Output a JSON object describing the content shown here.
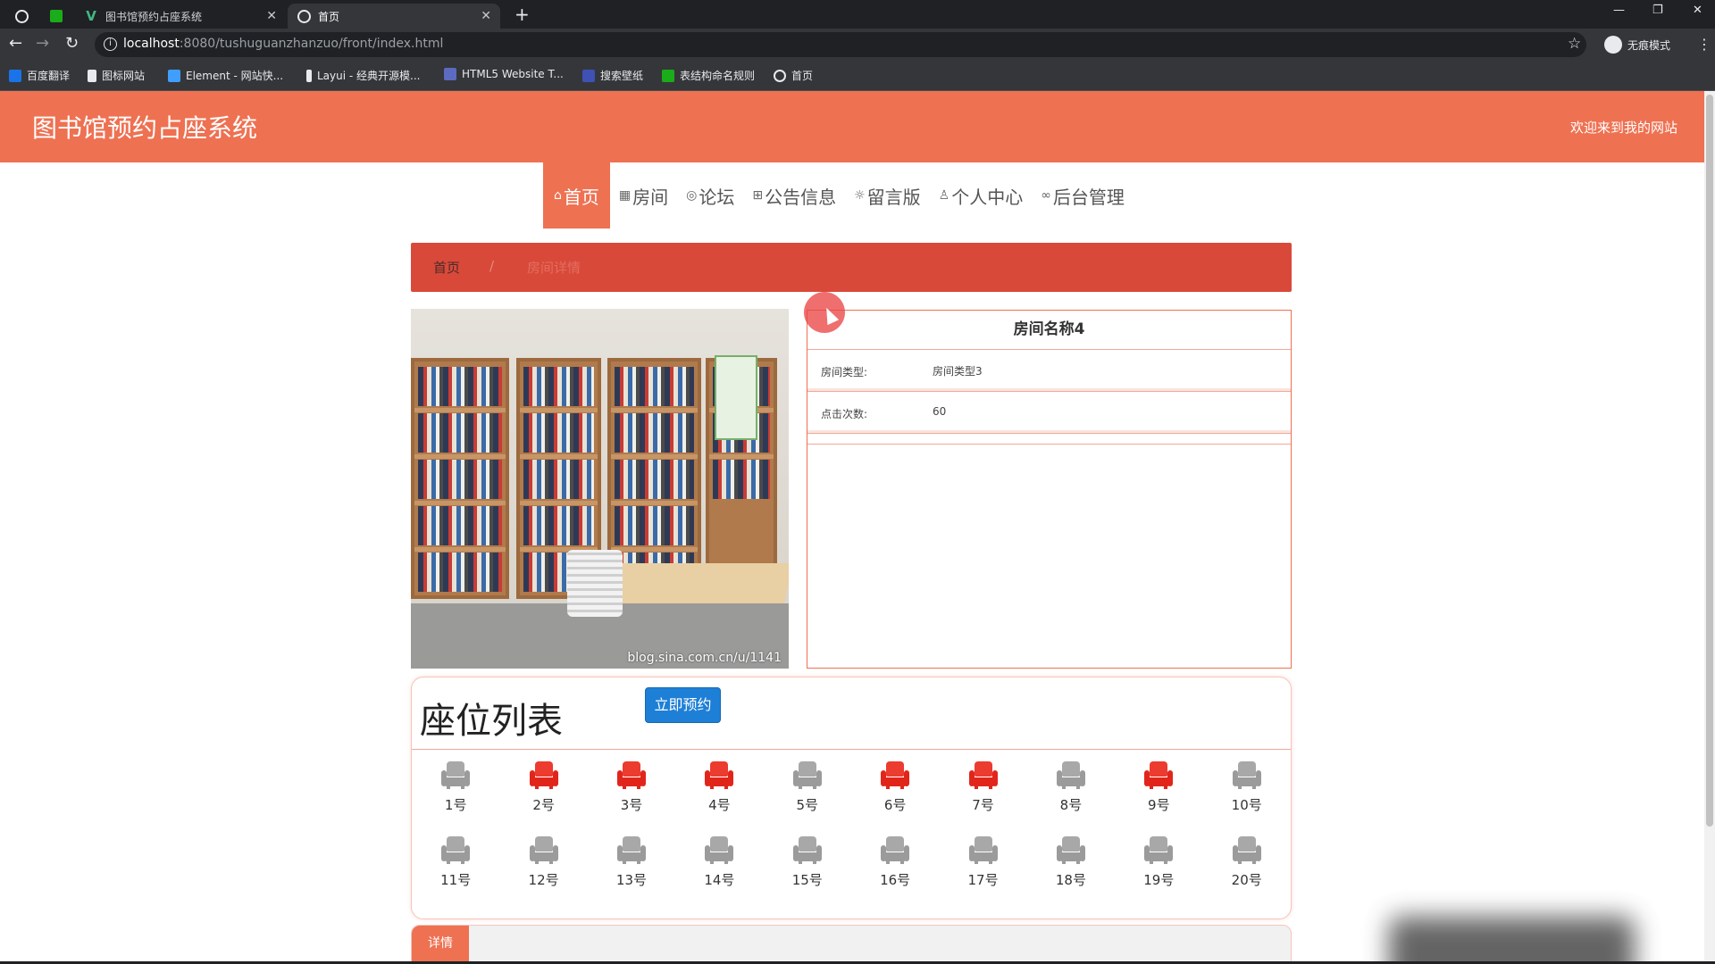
{
  "browser": {
    "tabs": [
      {
        "title": "图书馆预约占座系统",
        "active": false
      },
      {
        "title": "首页",
        "active": true
      }
    ],
    "url_host": "localhost",
    "url_rest": ":8080/tushuguanzhanzuo/front/index.html",
    "profile_label": "无痕模式",
    "bookmarks": [
      "百度翻译",
      "图标网站",
      "Element - 网站快...",
      "Layui - 经典开源模...",
      "HTML5 Website T...",
      "搜索壁纸",
      "表结构命名规则",
      "首页"
    ],
    "accent": "#35363a"
  },
  "site": {
    "title": "图书馆预约占座系统",
    "welcome": "欢迎来到我的网站",
    "brand_color": "#ee7152"
  },
  "nav": {
    "items": [
      {
        "icon": "home-icon",
        "label": "首页",
        "active": true
      },
      {
        "icon": "grid-icon",
        "label": "房间",
        "active": false
      },
      {
        "icon": "chat-icon",
        "label": "论坛",
        "active": false
      },
      {
        "icon": "book-icon",
        "label": "公告信息",
        "active": false
      },
      {
        "icon": "settings-icon",
        "label": "留言版",
        "active": false
      },
      {
        "icon": "user-icon",
        "label": "个人中心",
        "active": false
      },
      {
        "icon": "link-icon",
        "label": "后台管理",
        "active": false
      }
    ]
  },
  "breadcrumb": {
    "home": "首页",
    "separator": "/",
    "current": "房间详情"
  },
  "room": {
    "name": "房间名称4",
    "type_label": "房间类型:",
    "type_value": "房间类型3",
    "clicks_label": "点击次数:",
    "clicks_value": "60",
    "photo_watermark": "blog.sina.com.cn/u/1141"
  },
  "seats": {
    "title": "座位列表",
    "reserve_label": "立即预约",
    "taken_color": "#e2251b",
    "free_color": "#9b9b9b",
    "list": [
      {
        "label": "1号",
        "taken": false
      },
      {
        "label": "2号",
        "taken": true
      },
      {
        "label": "3号",
        "taken": true
      },
      {
        "label": "4号",
        "taken": true
      },
      {
        "label": "5号",
        "taken": false
      },
      {
        "label": "6号",
        "taken": true
      },
      {
        "label": "7号",
        "taken": true
      },
      {
        "label": "8号",
        "taken": false
      },
      {
        "label": "9号",
        "taken": true
      },
      {
        "label": "10号",
        "taken": false
      },
      {
        "label": "11号",
        "taken": false
      },
      {
        "label": "12号",
        "taken": false
      },
      {
        "label": "13号",
        "taken": false
      },
      {
        "label": "14号",
        "taken": false
      },
      {
        "label": "15号",
        "taken": false
      },
      {
        "label": "16号",
        "taken": false
      },
      {
        "label": "17号",
        "taken": false
      },
      {
        "label": "18号",
        "taken": false
      },
      {
        "label": "19号",
        "taken": false
      },
      {
        "label": "20号",
        "taken": false
      }
    ]
  },
  "detail": {
    "tab_label": "详情"
  }
}
